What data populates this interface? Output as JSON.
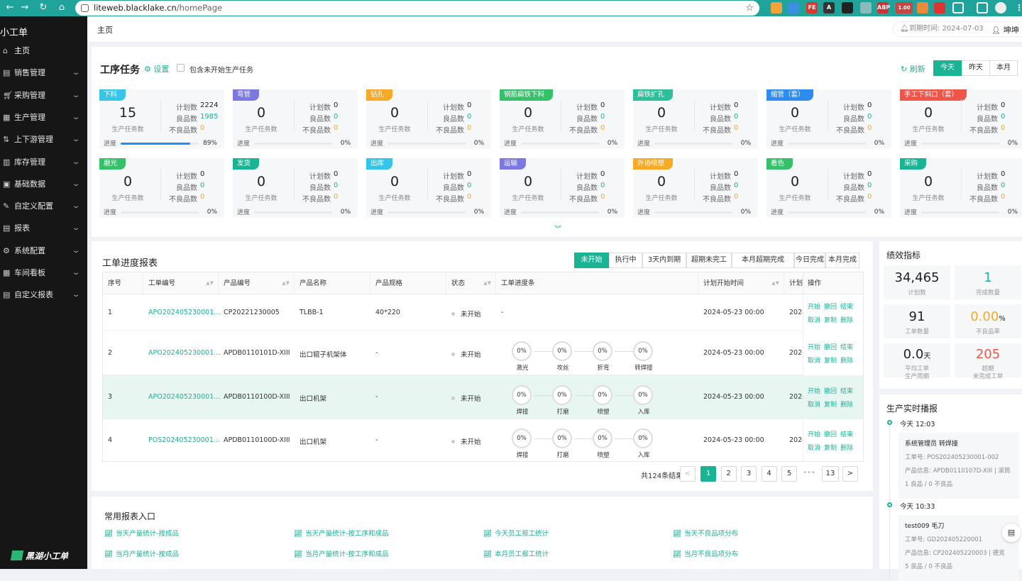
{
  "browser": {
    "url_host": "liteweb.blacklake.cn",
    "url_path": "/homePage",
    "ext_badge": "1.00"
  },
  "sidebar": {
    "app_title": "小工单",
    "items": [
      {
        "label": "主页",
        "icon": "home-icon",
        "active": true
      },
      {
        "label": "销售管理",
        "icon": "sales-icon"
      },
      {
        "label": "采购管理",
        "icon": "purchase-icon"
      },
      {
        "label": "生产管理",
        "icon": "production-icon"
      },
      {
        "label": "上下游管理",
        "icon": "supply-chain-icon"
      },
      {
        "label": "库存管理",
        "icon": "inventory-icon"
      },
      {
        "label": "基础数据",
        "icon": "database-icon"
      },
      {
        "label": "自定义配置",
        "icon": "config-icon"
      },
      {
        "label": "报表",
        "icon": "report-icon"
      },
      {
        "label": "系统配置",
        "icon": "settings-icon"
      },
      {
        "label": "车间看板",
        "icon": "dashboard-icon"
      },
      {
        "label": "自定义报表",
        "icon": "custom-report-icon"
      }
    ],
    "brand": "黑湖小工单"
  },
  "header": {
    "breadcrumb": "主页",
    "expire_text": "到期时间: 2024-07-03",
    "user": "坤坤"
  },
  "tasks": {
    "title": "工序任务",
    "settings_label": "设置",
    "include_label": "包含未开始生产任务",
    "refresh_label": "刷新",
    "ranges": [
      "今天",
      "昨天",
      "本月"
    ],
    "active_range": "今天",
    "labels": {
      "planned": "计划数",
      "good": "良品数",
      "bad": "不良品数",
      "task_count": "生产任务数",
      "progress": "进度"
    },
    "cards": [
      {
        "name": "下料",
        "color": "#36c5e8",
        "tasks": "15",
        "planned": "2224",
        "good": "1985",
        "bad": "0",
        "progress": 0.89,
        "progress_text": "89%"
      },
      {
        "name": "弯管",
        "color": "#7b79e0",
        "tasks": "0",
        "planned": "0",
        "good": "0",
        "bad": "0",
        "progress": 0,
        "progress_text": "0%"
      },
      {
        "name": "钻孔",
        "color": "#f7a928",
        "tasks": "0",
        "planned": "0",
        "good": "0",
        "bad": "0",
        "progress": 0,
        "progress_text": "0%"
      },
      {
        "name": "钢筋扁铁下料",
        "color": "#36c06a",
        "tasks": "0",
        "planned": "0",
        "good": "0",
        "bad": "0",
        "progress": 0,
        "progress_text": "0%"
      },
      {
        "name": "扁铁扩孔",
        "color": "#2bbf9a",
        "tasks": "0",
        "planned": "0",
        "good": "0",
        "bad": "0",
        "progress": 0,
        "progress_text": "0%"
      },
      {
        "name": "缩管（套）",
        "color": "#2d8cf0",
        "tasks": "0",
        "planned": "0",
        "good": "0",
        "bad": "0",
        "progress": 0,
        "progress_text": "0%"
      },
      {
        "name": "手工下斜口（套）",
        "color": "#f0554a",
        "tasks": "0",
        "planned": "0",
        "good": "0",
        "bad": "0",
        "progress": 0,
        "progress_text": "0%"
      },
      {
        "name": "磨光",
        "color": "#36c06a",
        "tasks": "0",
        "planned": "0",
        "good": "0",
        "bad": "0",
        "progress": 0,
        "progress_text": "0%"
      },
      {
        "name": "发货",
        "color": "#1ab394",
        "tasks": "0",
        "planned": "0",
        "good": "0",
        "bad": "0",
        "progress": 0,
        "progress_text": "0%"
      },
      {
        "name": "出库",
        "color": "#36c5e8",
        "tasks": "0",
        "planned": "0",
        "good": "0",
        "bad": "0",
        "progress": 0,
        "progress_text": "0%"
      },
      {
        "name": "运输",
        "color": "#7b79e0",
        "tasks": "0",
        "planned": "0",
        "good": "0",
        "bad": "0",
        "progress": 0,
        "progress_text": "0%"
      },
      {
        "name": "外协喷塑",
        "color": "#f7a928",
        "tasks": "0",
        "planned": "0",
        "good": "0",
        "bad": "0",
        "progress": 0,
        "progress_text": "0%"
      },
      {
        "name": "着色",
        "color": "#36c06a",
        "tasks": "0",
        "planned": "0",
        "good": "0",
        "bad": "0",
        "progress": 0,
        "progress_text": "0%"
      },
      {
        "name": "采购",
        "color": "#1ab394",
        "tasks": "0",
        "planned": "0",
        "good": "0",
        "bad": "0",
        "progress": 0,
        "progress_text": "0%"
      }
    ]
  },
  "workorders": {
    "title": "工单进度报表",
    "filters": [
      "未开始",
      "执行中",
      "3天内到期",
      "超期未完工",
      "本月超期完成",
      "今日完成",
      "本月完成"
    ],
    "active_filter": "未开始",
    "columns": [
      "序号",
      "工单编号",
      "产品编号",
      "产品名称",
      "产品规格",
      "状态",
      "工单进度条",
      "计划开始时间",
      "计划"
    ],
    "ops_header": "操作",
    "ops": [
      "开始",
      "撤回",
      "结束",
      "取消",
      "复制",
      "删除"
    ],
    "rows": [
      {
        "no": "1",
        "code": "APO202405230001...",
        "product_code": "CP20221230005",
        "product_name": "TLBB-1",
        "spec": "40*220",
        "status": "未开始",
        "no_steps": "-",
        "steps": [],
        "plan_start": "2024-05-23 00:00",
        "plan_end": "2024"
      },
      {
        "no": "2",
        "code": "APO202405230001...",
        "product_code": "APDB0110101D-XIII",
        "product_name": "出口辊子机架体",
        "spec": "-",
        "status": "未开始",
        "steps": [
          {
            "pct": "0%",
            "name": "激光"
          },
          {
            "pct": "0%",
            "name": "攻丝"
          },
          {
            "pct": "0%",
            "name": "折弯"
          },
          {
            "pct": "0%",
            "name": "转焊接"
          }
        ],
        "plan_start": "2024-05-23 00:00",
        "plan_end": "2024"
      },
      {
        "no": "3",
        "code": "APO202405230001...",
        "product_code": "APDB0110100D-XIII",
        "product_name": "出口机架",
        "spec": "-",
        "status": "未开始",
        "steps": [
          {
            "pct": "0%",
            "name": "焊接"
          },
          {
            "pct": "0%",
            "name": "打磨"
          },
          {
            "pct": "0%",
            "name": "喷塑"
          },
          {
            "pct": "0%",
            "name": "入库"
          }
        ],
        "plan_start": "2024-05-23 00:00",
        "plan_end": "2024"
      },
      {
        "no": "4",
        "code": "POS202405230001...",
        "product_code": "APDB0110100D-XIII",
        "product_name": "出口机架",
        "spec": "-",
        "status": "未开始",
        "steps": [
          {
            "pct": "0%",
            "name": "焊接"
          },
          {
            "pct": "0%",
            "name": "打磨"
          },
          {
            "pct": "0%",
            "name": "喷塑"
          },
          {
            "pct": "0%",
            "name": "入库"
          }
        ],
        "plan_start": "2024-05-23 00:00",
        "plan_end": "2024"
      }
    ],
    "pagination": {
      "total_text": "共124条结果",
      "prev": "<",
      "pages": [
        "1",
        "2",
        "3",
        "4",
        "5"
      ],
      "ellipsis": "•••",
      "last": "13",
      "next": ">",
      "current": "1"
    }
  },
  "reports": {
    "title": "常用报表入口",
    "links": [
      "当天产量统计-按成品",
      "当天产量统计-按工序和成品",
      "今天员工报工统计",
      "当天不良品项分布",
      "当月产量统计-按成品",
      "当月产量统计-按工序和成品",
      "本月员工报工统计",
      "当月不良品项分布"
    ]
  },
  "kpi": {
    "title": "绩效指标",
    "items": [
      {
        "value": "34,465",
        "unit": "",
        "label": "计划数",
        "color": "#222222"
      },
      {
        "value": "1",
        "unit": "",
        "label": "完成数量",
        "color": "#1ab394"
      },
      {
        "value": "91",
        "unit": "",
        "label": "工单数量",
        "color": "#222222"
      },
      {
        "value": "0.00",
        "unit": "%",
        "label": "不良品率",
        "color": "#f7a928"
      },
      {
        "value": "0.0",
        "unit": "天",
        "label": "平均工单",
        "label2": "生产周期",
        "color": "#222222"
      },
      {
        "value": "205",
        "unit": "",
        "label": "超期",
        "label2": "未完成工单",
        "color": "#f0554a"
      }
    ]
  },
  "feed": {
    "title": "生产实时播报",
    "events": [
      {
        "time": "今天 12:03",
        "title": "系统管理员 转焊接",
        "order": "工单号: POS202405230001-002",
        "product": "产品信息: APDB0110107D-XIII | 滚筒",
        "qty": "1 良品 / 0 不良品"
      },
      {
        "time": "今天 10:33",
        "title": "test009 毛刀",
        "order": "工单号: GD202405220001",
        "product": "产品信息: CP202405220003 | 德克",
        "qty": "5 良品 / 0 不良品"
      }
    ]
  }
}
